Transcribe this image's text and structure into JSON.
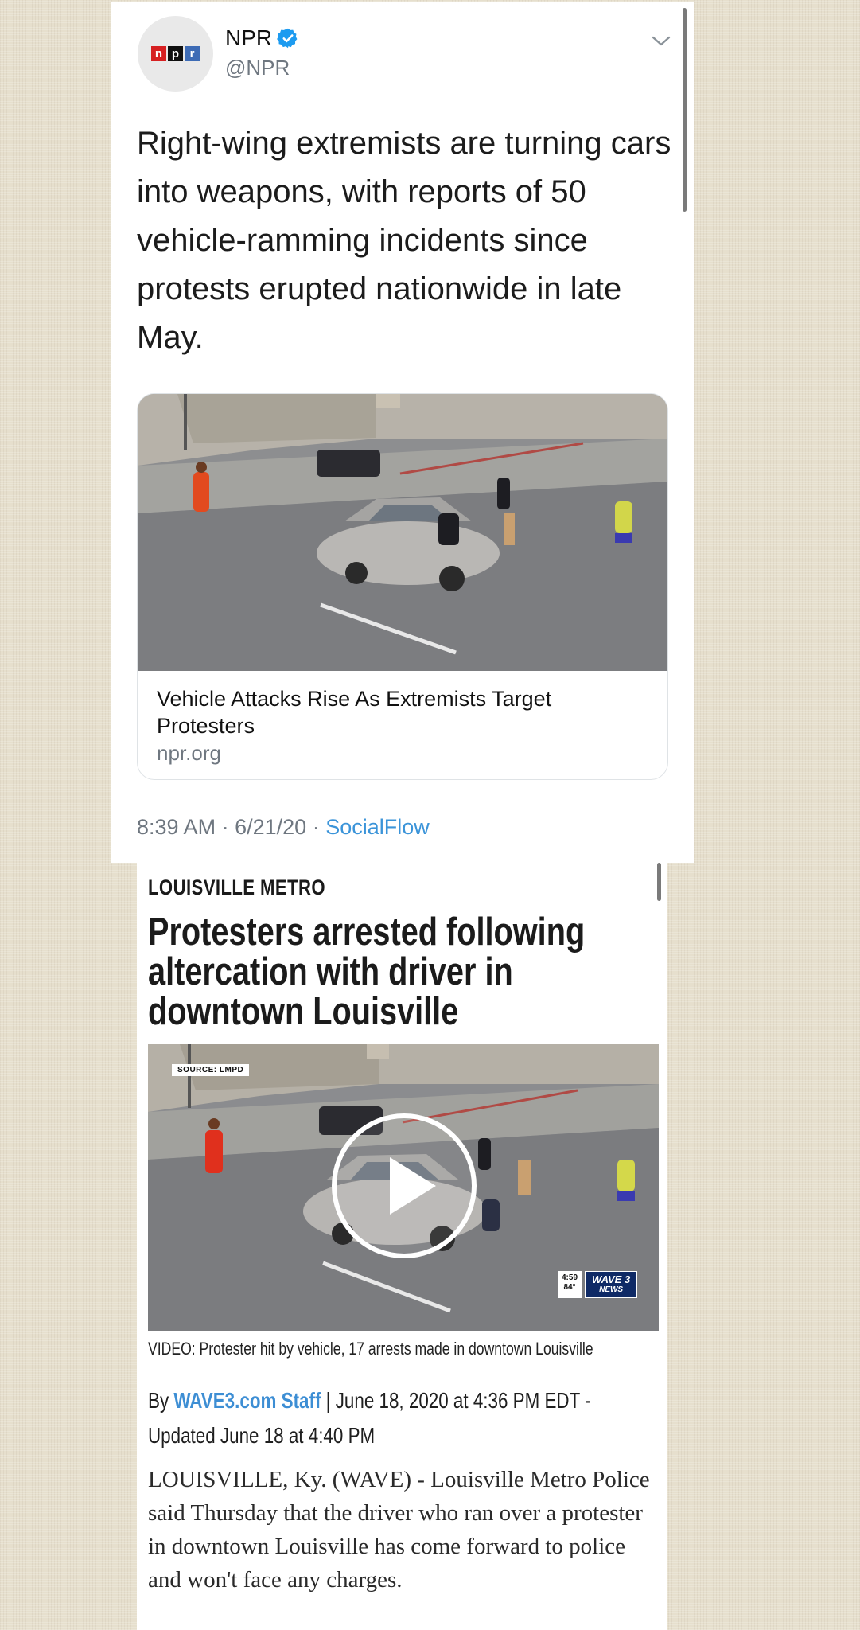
{
  "tweet": {
    "display_name": "NPR",
    "handle": "@NPR",
    "avatar_logo_letters": [
      "n",
      "p",
      "r"
    ],
    "text": "Right-wing extremists are turning cars into weapons, with reports of 50 vehicle-ramming incidents since protests erupted nationwide in late May.",
    "link_card": {
      "title": "Vehicle Attacks Rise As Extremists Target Protesters",
      "domain": "npr.org"
    },
    "time": "8:39 AM",
    "date": "6/21/20",
    "separator": "·",
    "source": "SocialFlow",
    "verified_icon": "verified-badge-icon",
    "menu_icon": "chevron-down-icon"
  },
  "article": {
    "section": "LOUISVILLE METRO",
    "headline": "Protesters arrested following altercation with driver in downtown Louisville",
    "video": {
      "source_tag": "SOURCE: LMPD",
      "time": "4:59",
      "temperature": "84°",
      "station_logo": "WAVE 3",
      "station_logo_sub": "NEWS",
      "play_icon": "play-icon"
    },
    "caption": "VIDEO: Protester hit by vehicle, 17 arrests made in downtown Louisville",
    "byline": {
      "prefix": "By",
      "author": "WAVE3.com Staff",
      "separator": "|",
      "date": "June 18, 2020 at 4:36 PM EDT - Updated June 18 at 4:40 PM"
    },
    "body": "LOUISVILLE, Ky. (WAVE) - Louisville Metro Police said Thursday that the driver who ran over a protester in downtown Louisville has come forward to police and won't face any charges."
  },
  "colors": {
    "link_blue": "#3b94d9",
    "author_blue": "#3d8ed4",
    "verified_blue": "#1d9bf0",
    "muted_gray": "#6f7780",
    "background": "#e6dfcd"
  }
}
